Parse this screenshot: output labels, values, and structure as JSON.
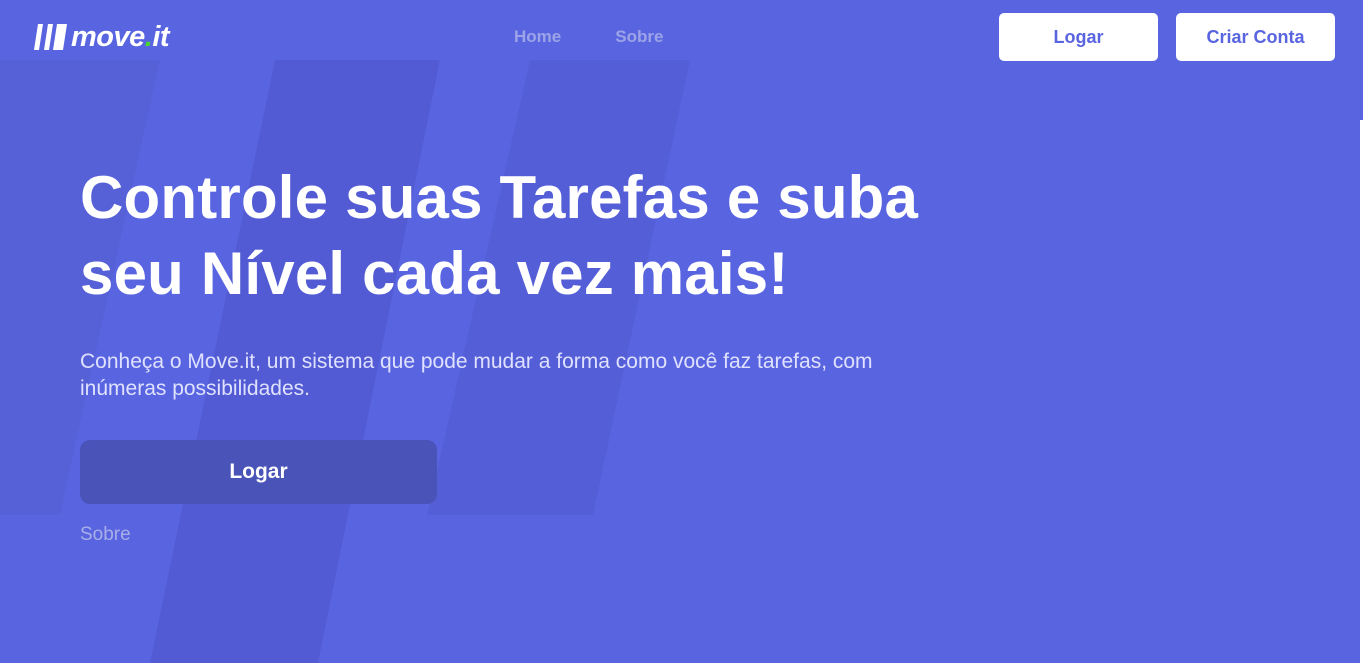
{
  "brand": {
    "logo_text": "move",
    "logo_dot": ".",
    "logo_suffix": "it",
    "icon": "logo-bars-icon",
    "accent_color": "#4cd62b"
  },
  "nav": {
    "items": [
      {
        "label": "Home"
      },
      {
        "label": "Sobre"
      }
    ]
  },
  "header_actions": {
    "login_label": "Logar",
    "signup_label": "Criar Conta"
  },
  "hero": {
    "title": "Controle suas Tarefas e suba seu Nível cada vez mais!",
    "subtitle": "Conheça o Move.it, um sistema que pode mudar a forma como você faz tarefas, com inúmeras possibilidades.",
    "cta_label": "Logar",
    "secondary_link": "Sobre"
  },
  "colors": {
    "background": "#5965e0",
    "button_text": "#5965e0",
    "hero_button": "#4953b8"
  }
}
